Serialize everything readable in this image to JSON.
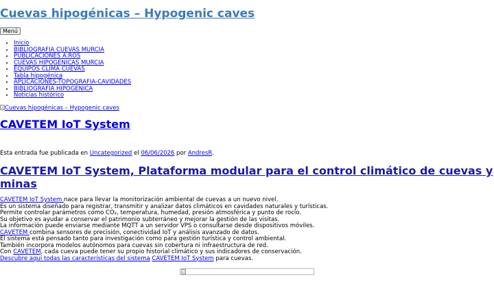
{
  "site": {
    "title": "Cuevas hipogénicas – Hypogenic caves",
    "menu_button": "Menú",
    "header_image_alt": "Cuevas hipogénicas – Hypogenic caves"
  },
  "nav": {
    "items": [
      "Inicio",
      "BIBLIOGRAFIA CUEVAS MURCIA",
      "PUBLICACIONES A.ROS",
      "CUEVAS HIPOGENICAS MURCIA",
      "EQUIPOS CLIMA CUEVAS",
      "Tabla hipogénica",
      "APLICACIONES-TOPOGRAFIA-CAVIDADES",
      "BIBLIOGRAFIA HIPOGENICA",
      "Noticias histórico"
    ]
  },
  "post": {
    "title": "CAVETEM IoT System",
    "meta": {
      "prefix": "Esta entrada fue publicada en ",
      "category": "Uncategorized",
      "on": " el ",
      "date": "06/06/2026",
      "by": " por ",
      "author": "AndresR",
      "end": "."
    },
    "heading": "CAVETEM IoT System, Plataforma modular para el control climático de cuevas y minas",
    "lines": {
      "l1_link": "CAVETEM IoT System ",
      "l1_text": "nace para llevar la monitorización ambiental de cuevas a un nuevo nivel.",
      "l2": "Es un sistema diseñado para registrar, transmitir y analizar datos climáticos en cavidades naturales y turísticas.",
      "l3": "Permite controlar parámetros como CO₂, temperatura, humedad, presión atmosférica y punto de rocío.",
      "l4": "Su objetivo es ayudar a conservar el patrimonio subterráneo y mejorar la gestión de las visitas.",
      "l5": "La información puede enviarse mediante MQTT a un servidor VPS o consultarse desde dispositivos móviles.",
      "l6_link": "CAVETEM ",
      "l6_text": "combina sensores de precisión, conectividad IoT y análisis avanzado de datos.",
      "l7": "El sistema está pensado tanto para investigación como para gestión turística y control ambiental.",
      "l8": "También incorpora modelos autónomos para cuevas sin cobertura ni infraestructura de red.",
      "l9_pre": "Con ",
      "l9_link": "CAVETEM",
      "l9_text": ", cada cueva puede tener su propio historial climático y sus indicadores de conservación.",
      "l10_link1": "Descubre aquí todas las características del sistema",
      "l10_sep": " ",
      "l10_link2": "CAVETEM IoT System",
      "l10_text": " para cuevas."
    }
  }
}
